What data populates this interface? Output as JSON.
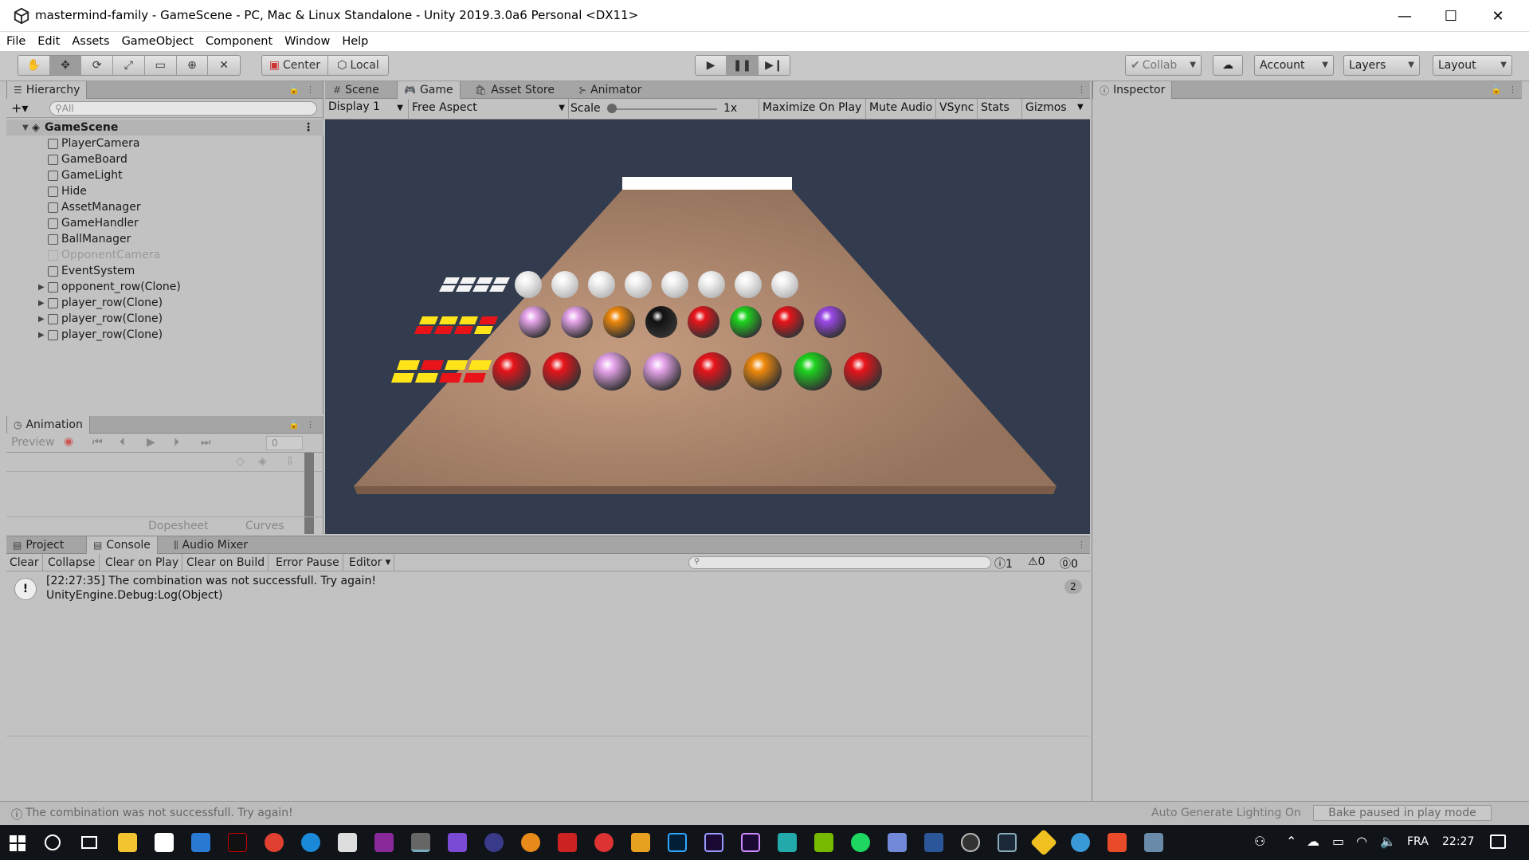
{
  "window": {
    "title": "mastermind-family - GameScene - PC, Mac & Linux Standalone - Unity 2019.3.0a6 Personal <DX11>",
    "minimize": "—",
    "maximize": "☐",
    "close": "✕"
  },
  "menu": [
    "File",
    "Edit",
    "Assets",
    "GameObject",
    "Component",
    "Window",
    "Help"
  ],
  "toolbar": {
    "pivot": "Center",
    "space": "Local",
    "collab": "Collab",
    "account": "Account",
    "layers": "Layers",
    "layout": "Layout"
  },
  "hierarchy": {
    "tab": "Hierarchy",
    "search_placeholder": "All",
    "scene": "GameScene",
    "items": [
      {
        "name": "PlayerCamera",
        "expand": false,
        "faded": false
      },
      {
        "name": "GameBoard",
        "expand": false,
        "faded": false
      },
      {
        "name": "GameLight",
        "expand": false,
        "faded": false
      },
      {
        "name": "Hide",
        "expand": false,
        "faded": false
      },
      {
        "name": "AssetManager",
        "expand": false,
        "faded": false
      },
      {
        "name": "GameHandler",
        "expand": false,
        "faded": false
      },
      {
        "name": "BallManager",
        "expand": false,
        "faded": false
      },
      {
        "name": "OpponentCamera",
        "expand": false,
        "faded": true
      },
      {
        "name": "EventSystem",
        "expand": false,
        "faded": false
      },
      {
        "name": "opponent_row(Clone)",
        "expand": true,
        "faded": false
      },
      {
        "name": "player_row(Clone)",
        "expand": true,
        "faded": false
      },
      {
        "name": "player_row(Clone)",
        "expand": true,
        "faded": false
      },
      {
        "name": "player_row(Clone)",
        "expand": true,
        "faded": false
      }
    ]
  },
  "animation": {
    "tab": "Animation",
    "preview": "Preview",
    "frame": "0",
    "dopesheet": "Dopesheet",
    "curves": "Curves"
  },
  "view_tabs": [
    "Scene",
    "Game",
    "Asset Store",
    "Animator"
  ],
  "game_bar": {
    "display": "Display 1",
    "aspect": "Free Aspect",
    "scale_label": "Scale",
    "scale_value": "1x",
    "maximize": "Maximize On Play",
    "mute": "Mute Audio",
    "vsync": "VSync",
    "stats": "Stats",
    "gizmos": "Gizmos"
  },
  "inspector": {
    "tab": "Inspector"
  },
  "bottom_tabs": [
    "Project",
    "Console",
    "Audio Mixer"
  ],
  "console": {
    "buttons": [
      "Clear",
      "Collapse",
      "Clear on Play",
      "Clear on Build",
      "Error Pause",
      "Editor"
    ],
    "count_info": "1",
    "count_warn": "0",
    "count_error": "0",
    "log_line1": "[22:27:35] The combination was not successfull. Try again!",
    "log_line2": "UnityEngine.Debug:Log(Object)",
    "log_count": "2"
  },
  "status": {
    "message": "The combination was not successfull. Try again!",
    "lighting": "Auto Generate Lighting On",
    "bake": "Bake paused in play mode"
  },
  "taskbar": {
    "lang": "FRA",
    "time": "22:27"
  },
  "scene_colors": {
    "white": "#f4f4f4",
    "pink": "#e8a6ec",
    "orange": "#f08a0c",
    "black": "#111111",
    "red": "#e8141a",
    "green": "#1ed41e",
    "purple": "#9a48e6",
    "yellow": "#ffe41a",
    "board": "#9a7660"
  },
  "board_rows": [
    {
      "pegs": [
        [
          "white",
          "white",
          "white",
          "white"
        ],
        [
          "white",
          "white",
          "white",
          "white"
        ]
      ],
      "balls": [
        "white",
        "white",
        "white",
        "white",
        "white",
        "white",
        "white",
        "white"
      ]
    },
    {
      "pegs": [
        [
          "yellow",
          "yellow",
          "yellow",
          "red"
        ],
        [
          "red",
          "red",
          "red",
          "yellow"
        ]
      ],
      "balls": [
        "pink",
        "pink",
        "orange",
        "black",
        "red",
        "green",
        "red",
        "purple"
      ]
    },
    {
      "pegs": [
        [
          "yellow",
          "red",
          "yellow",
          "yellow"
        ],
        [
          "yellow",
          "yellow",
          "red",
          "red"
        ]
      ],
      "balls": [
        "red",
        "red",
        "pink",
        "pink",
        "red",
        "orange",
        "green",
        "red"
      ]
    }
  ]
}
